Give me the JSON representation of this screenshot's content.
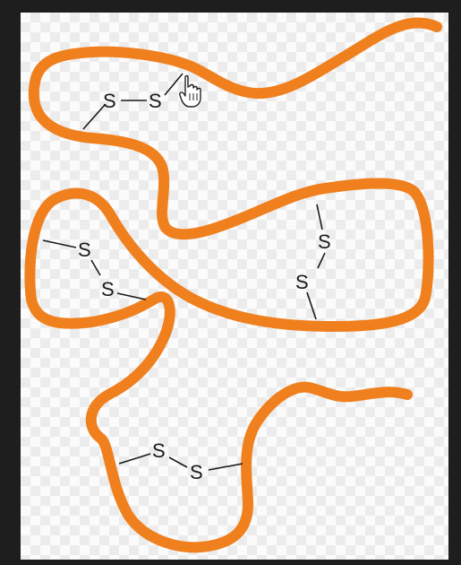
{
  "diagram": {
    "chain_color": "#f07f1e",
    "bridges": [
      {
        "atom1": "S",
        "atom2": "S"
      },
      {
        "atom1": "S",
        "atom2": "S"
      },
      {
        "atom1": "S",
        "atom2": "S"
      },
      {
        "atom1": "S",
        "atom2": "S"
      }
    ]
  },
  "cursor": {
    "icon": "hand-pointer-icon"
  }
}
